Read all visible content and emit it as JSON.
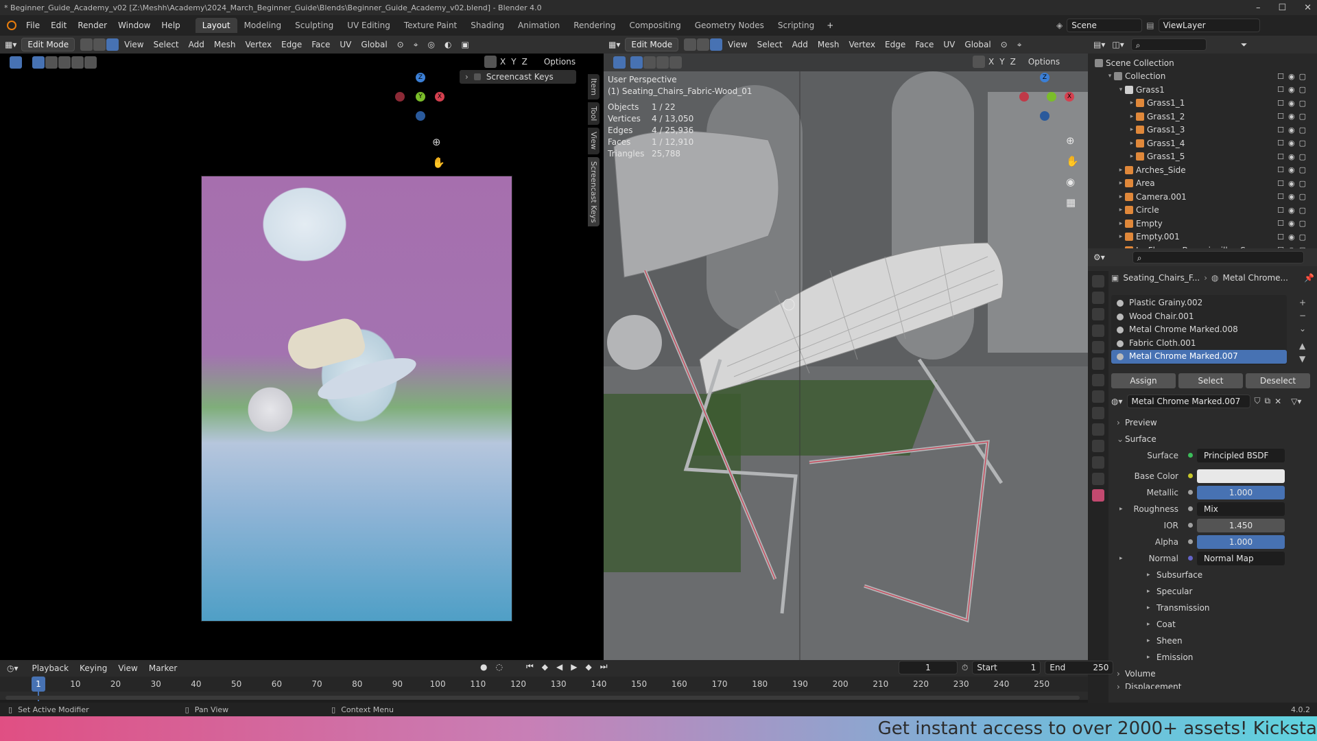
{
  "window": {
    "title": "* Beginner_Guide_Academy_v02 [Z:\\Meshh\\Academy\\2024_March_Beginner_Guide\\Blends\\Beginner_Guide_Academy_v02.blend] - Blender 4.0"
  },
  "menu": [
    "File",
    "Edit",
    "Render",
    "Window",
    "Help"
  ],
  "workspaces": [
    "Layout",
    "Modeling",
    "Sculpting",
    "UV Editing",
    "Texture Paint",
    "Shading",
    "Animation",
    "Rendering",
    "Compositing",
    "Geometry Nodes",
    "Scripting"
  ],
  "scene": {
    "scene_label": "Scene",
    "view_layer": "ViewLayer"
  },
  "left_view": {
    "mode": "Edit Mode",
    "menus": [
      "View",
      "Select",
      "Add",
      "Mesh",
      "Vertex",
      "Edge",
      "Face",
      "UV"
    ],
    "orientation": "Global",
    "axes": [
      "X",
      "Y",
      "Z"
    ],
    "options": "Options",
    "screencast_panel": "Screencast Keys",
    "side_tabs": [
      "Item",
      "Tool",
      "View",
      "Screencast Keys"
    ]
  },
  "right_view": {
    "mode": "Edit Mode",
    "menus": [
      "View",
      "Select",
      "Add",
      "Mesh",
      "Vertex",
      "Edge",
      "Face",
      "UV"
    ],
    "orientation": "Global",
    "axes": [
      "X",
      "Y",
      "Z"
    ],
    "options": "Options",
    "perspective": "User Perspective",
    "object": "(1) Seating_Chairs_Fabric-Wood_01",
    "stats": [
      {
        "label": "Objects",
        "value": "1 / 22"
      },
      {
        "label": "Vertices",
        "value": "4 / 13,050"
      },
      {
        "label": "Edges",
        "value": "4 / 25,936"
      },
      {
        "label": "Faces",
        "value": "1 / 12,910"
      },
      {
        "label": "Triangles",
        "value": "25,788"
      }
    ]
  },
  "outliner": {
    "rows": [
      {
        "name": "Scene Collection",
        "level": 0
      },
      {
        "name": "Collection",
        "level": 1
      },
      {
        "name": "Grass1",
        "level": 2
      },
      {
        "name": "Grass1_1",
        "level": 3
      },
      {
        "name": "Grass1_2",
        "level": 3
      },
      {
        "name": "Grass1_3",
        "level": 3
      },
      {
        "name": "Grass1_4",
        "level": 3
      },
      {
        "name": "Grass1_5",
        "level": 3
      },
      {
        "name": "Arches_Side",
        "level": 2
      },
      {
        "name": "Area",
        "level": 2
      },
      {
        "name": "Camera.001",
        "level": 2
      },
      {
        "name": "Circle",
        "level": 2
      },
      {
        "name": "Empty",
        "level": 2
      },
      {
        "name": "Empty.001",
        "level": 2
      },
      {
        "name": "IvyFlowers Bougainvillea Square",
        "level": 2
      }
    ]
  },
  "properties": {
    "breadcrumb_object": "Seating_Chairs_F...",
    "breadcrumb_material": "Metal Chrome...",
    "slots": [
      "Plastic Grainy.002",
      "Wood Chair.001",
      "Metal Chrome Marked.008",
      "Fabric Cloth.001",
      "Metal Chrome Marked.007"
    ],
    "active_slot_index": 4,
    "buttons": {
      "assign": "Assign",
      "select": "Select",
      "deselect": "Deselect"
    },
    "material_name": "Metal Chrome Marked.007",
    "preview": "Preview",
    "surface_section": "Surface",
    "surface": {
      "label": "Surface",
      "value": "Principled BSDF"
    },
    "base_color": {
      "label": "Base Color"
    },
    "metallic": {
      "label": "Metallic",
      "value": "1.000"
    },
    "roughness": {
      "label": "Roughness",
      "value": "Mix"
    },
    "ior": {
      "label": "IOR",
      "value": "1.450"
    },
    "alpha": {
      "label": "Alpha",
      "value": "1.000"
    },
    "normal": {
      "label": "Normal",
      "value": "Normal Map"
    },
    "subsections": [
      "Subsurface",
      "Specular",
      "Transmission",
      "Coat",
      "Sheen",
      "Emission"
    ],
    "volume": "Volume",
    "displacement": "Displacement"
  },
  "timeline": {
    "menus": [
      "Playback",
      "Keying",
      "View",
      "Marker"
    ],
    "current_frame": "1",
    "start_label": "Start",
    "start": "1",
    "end_label": "End",
    "end": "250",
    "ticks": [
      "1",
      "10",
      "20",
      "30",
      "40",
      "50",
      "60",
      "70",
      "80",
      "90",
      "100",
      "110",
      "120",
      "130",
      "140",
      "150",
      "160",
      "170",
      "180",
      "190",
      "200",
      "210",
      "220",
      "230",
      "240",
      "250"
    ]
  },
  "status": {
    "left": "Set Active Modifier",
    "mid": "Pan View",
    "right": "Context Menu",
    "version": "4.0.2"
  },
  "banner": "Get instant access to over 2000+ assets! Kicksta"
}
